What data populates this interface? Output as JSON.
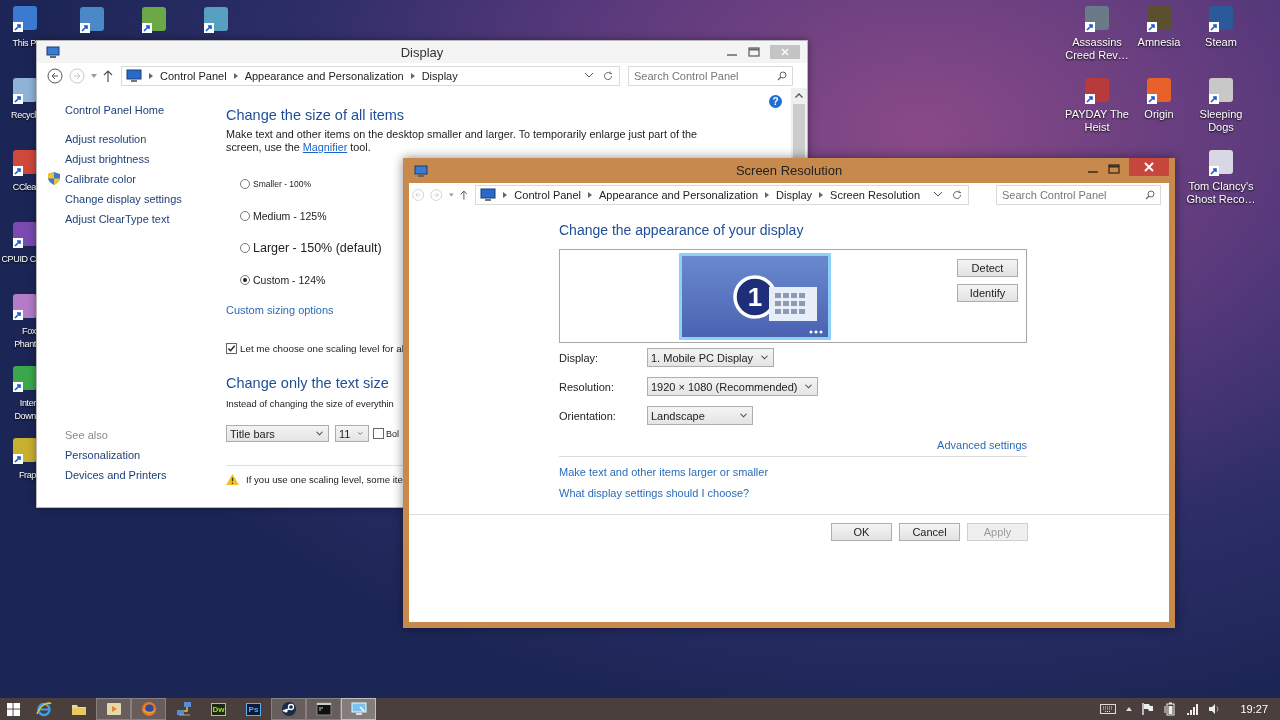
{
  "desktop": {
    "left_icons": [
      {
        "lines": [
          "This P"
        ],
        "color": "#3a7ad0"
      },
      {
        "lines": [
          "Recycl"
        ],
        "color": "#8fb3d6"
      },
      {
        "lines": [
          "CClea"
        ],
        "color": "#d0483a"
      },
      {
        "lines": [
          "CPUID C"
        ],
        "color": "#7a4ab0"
      },
      {
        "lines": [
          "Fox",
          "Phant"
        ],
        "color": "#b47cc8"
      },
      {
        "lines": [
          "Inter",
          "Down"
        ],
        "color": "#3aa84a"
      },
      {
        "lines": [
          "Frap"
        ],
        "color": "#c8b030"
      }
    ],
    "top_icons": [
      {
        "color": "#4a88c8"
      },
      {
        "color": "#6aa848"
      },
      {
        "color": "#58a0c0"
      }
    ],
    "right_icon_columns": [
      [
        {
          "lines": [
            "Assassins",
            "Creed Rev…"
          ],
          "color": "#6a7a88"
        },
        {
          "lines": [
            "PAYDAY The",
            "Heist"
          ],
          "color": "#b83a3a"
        }
      ],
      [
        {
          "lines": [
            "Amnesia"
          ],
          "color": "#5a5030"
        },
        {
          "lines": [
            "Origin"
          ],
          "color": "#e8602a"
        }
      ],
      [
        {
          "lines": [
            "Steam"
          ],
          "color": "#2a5a9a"
        },
        {
          "lines": [
            "Sleeping",
            "Dogs"
          ],
          "color": "#c8c8c8"
        },
        {
          "lines": [
            "Tom Clancy's",
            "Ghost Reco…"
          ],
          "color": "#d8d8e4"
        }
      ]
    ]
  },
  "display_window": {
    "title": "Display",
    "active": false,
    "nav": {
      "back_enabled": true,
      "forward_enabled": false
    },
    "breadcrumbs": [
      "Control Panel",
      "Appearance and Personalization",
      "Display"
    ],
    "search": {
      "placeholder": "Search Control Panel"
    },
    "help_button": "?",
    "sidebar": {
      "links": [
        {
          "label": "Control Panel Home",
          "shield": false
        },
        {
          "label": "Adjust resolution",
          "shield": false
        },
        {
          "label": "Adjust brightness",
          "shield": false
        },
        {
          "label": "Calibrate color",
          "shield": true
        },
        {
          "label": "Change display settings",
          "shield": false
        },
        {
          "label": "Adjust ClearType text",
          "shield": false
        }
      ],
      "see_also": {
        "heading": "See also",
        "links": [
          "Personalization",
          "Devices and Printers"
        ]
      }
    },
    "content": {
      "heading": "Change the size of all items",
      "description": {
        "before": "Make text and other items on the desktop smaller and larger. To temporarily enlarge just part of the screen, use the ",
        "link": "Magnifier",
        "after": " tool."
      },
      "scale_options": [
        {
          "label": "Smaller - 100%",
          "kind": "small",
          "selected": false
        },
        {
          "label": "Medium - 125%",
          "kind": "medium",
          "selected": false
        },
        {
          "label": "Larger - 150% (default)",
          "kind": "large",
          "selected": false
        },
        {
          "label": "Custom - 124%",
          "kind": "medium",
          "selected": true
        }
      ],
      "custom_link": "Custom sizing options",
      "one_level_checkbox": {
        "label": "Let me choose one scaling level for al",
        "checked": true
      },
      "text_size_heading": "Change only the text size",
      "text_size_description": "Instead of changing the size of everythin",
      "item_dropdown": "Title bars",
      "size_dropdown": "11",
      "bold_checkbox": {
        "label": "Bol",
        "checked": false
      },
      "warning": "If you use one scaling level, some ite"
    }
  },
  "resolution_window": {
    "title": "Screen Resolution",
    "active": true,
    "nav": {
      "back_enabled": false,
      "forward_enabled": false
    },
    "breadcrumbs": [
      "Control Panel",
      "Appearance and Personalization",
      "Display",
      "Screen Resolution"
    ],
    "search": {
      "placeholder": "Search Control Panel"
    },
    "heading": "Change the appearance of your display",
    "monitor": {
      "number": "1",
      "selected": true
    },
    "detect_button": "Detect",
    "identify_button": "Identify",
    "fields": [
      {
        "label": "Display:",
        "value": "1. Mobile PC Display"
      },
      {
        "label": "Resolution:",
        "value": "1920 × 1080 (Recommended)"
      },
      {
        "label": "Orientation:",
        "value": "Landscape"
      }
    ],
    "advanced_link": "Advanced settings",
    "links": [
      "Make text and other items larger or smaller",
      "What display settings should I choose?"
    ],
    "buttons": [
      {
        "label": "OK",
        "disabled": false
      },
      {
        "label": "Cancel",
        "disabled": false
      },
      {
        "label": "Apply",
        "disabled": true
      }
    ]
  },
  "taskbar": {
    "apps": [
      {
        "kind": "start",
        "running": false,
        "selected": false
      },
      {
        "kind": "ie",
        "running": false,
        "selected": false
      },
      {
        "kind": "explorer",
        "running": false,
        "selected": false
      },
      {
        "kind": "media",
        "running": true,
        "selected": false
      },
      {
        "kind": "firefox",
        "running": true,
        "selected": false
      },
      {
        "kind": "network",
        "running": false,
        "selected": false
      },
      {
        "kind": "dw",
        "text": "Dw",
        "running": false,
        "selected": false
      },
      {
        "kind": "ps",
        "text": "Ps",
        "running": false,
        "selected": false
      },
      {
        "kind": "steam",
        "running": true,
        "selected": false
      },
      {
        "kind": "cmd",
        "running": true,
        "selected": false
      },
      {
        "kind": "control",
        "running": true,
        "selected": true
      }
    ],
    "tray": [
      {
        "kind": "keyboard"
      },
      {
        "kind": "overflow"
      },
      {
        "kind": "flag"
      },
      {
        "kind": "battery"
      },
      {
        "kind": "signal"
      },
      {
        "kind": "volume"
      }
    ],
    "clock": "19:27"
  }
}
